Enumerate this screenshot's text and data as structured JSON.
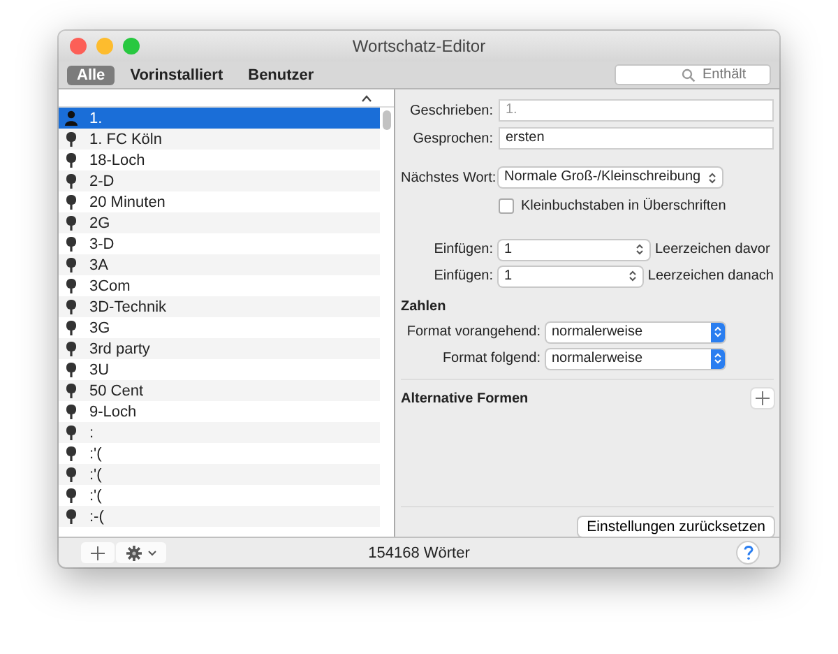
{
  "window": {
    "title": "Wortschatz-Editor"
  },
  "tabs": [
    {
      "label": "Alle",
      "selected": true
    },
    {
      "label": "Vorinstalliert",
      "selected": false
    },
    {
      "label": "Benutzer",
      "selected": false
    }
  ],
  "search": {
    "placeholder": "Enthält"
  },
  "word_list": {
    "items": [
      {
        "text": "1.",
        "kind": "user",
        "selected": true
      },
      {
        "text": "1. FC Köln",
        "kind": "system",
        "selected": false
      },
      {
        "text": "18-Loch",
        "kind": "system",
        "selected": false
      },
      {
        "text": "2-D",
        "kind": "system",
        "selected": false
      },
      {
        "text": "20 Minuten",
        "kind": "system",
        "selected": false
      },
      {
        "text": "2G",
        "kind": "system",
        "selected": false
      },
      {
        "text": "3-D",
        "kind": "system",
        "selected": false
      },
      {
        "text": "3A",
        "kind": "system",
        "selected": false
      },
      {
        "text": "3Com",
        "kind": "system",
        "selected": false
      },
      {
        "text": "3D-Technik",
        "kind": "system",
        "selected": false
      },
      {
        "text": "3G",
        "kind": "system",
        "selected": false
      },
      {
        "text": "3rd party",
        "kind": "system",
        "selected": false
      },
      {
        "text": "3U",
        "kind": "system",
        "selected": false
      },
      {
        "text": "50 Cent",
        "kind": "system",
        "selected": false
      },
      {
        "text": "9-Loch",
        "kind": "system",
        "selected": false
      },
      {
        "text": ":",
        "kind": "system",
        "selected": false
      },
      {
        "text": ":'(",
        "kind": "system",
        "selected": false
      },
      {
        "text": ":'(",
        "kind": "system",
        "selected": false
      },
      {
        "text": ":'(",
        "kind": "system",
        "selected": false
      },
      {
        "text": ":-(",
        "kind": "system",
        "selected": false
      }
    ]
  },
  "details": {
    "written": {
      "label": "Geschrieben:",
      "value": "1.",
      "disabled": true
    },
    "spoken": {
      "label": "Gesprochen:",
      "value": "ersten"
    },
    "next_word": {
      "label": "Nächstes Wort:",
      "value": "Normale Groß-/Kleinschreibung"
    },
    "lowercase_checkbox": {
      "label": "Kleinbuchstaben in Überschriften",
      "checked": false
    },
    "insert": [
      {
        "label": "Einfügen:",
        "value": "1",
        "suffix": "Leerzeichen davor"
      },
      {
        "label": "Einfügen:",
        "value": "1",
        "suffix": "Leerzeichen danach"
      }
    ],
    "numbers": {
      "heading": "Zahlen",
      "fields": [
        {
          "label": "Format vorangehend:",
          "value": "normalerweise"
        },
        {
          "label": "Format folgend:",
          "value": "normalerweise"
        }
      ]
    },
    "alternatives": {
      "heading": "Alternative Formen"
    },
    "reset_button": "Einstellungen zurücksetzen"
  },
  "status_bar": {
    "count": "154168 Wörter"
  }
}
